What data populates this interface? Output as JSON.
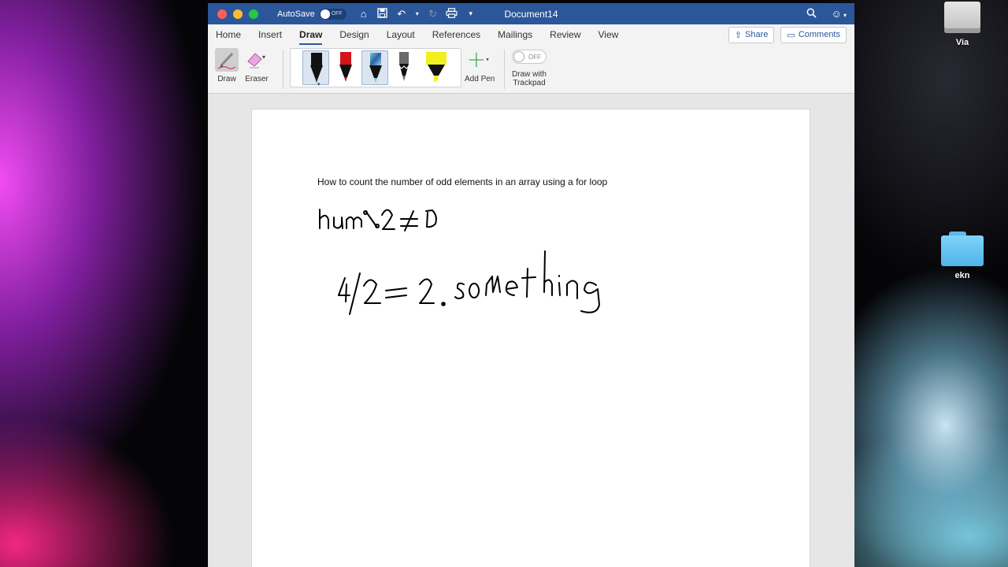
{
  "desktop": {
    "icons": [
      {
        "label": "Via",
        "type": "drive-icon"
      },
      {
        "label": "ekn",
        "type": "folder-icon"
      }
    ]
  },
  "titlebar": {
    "autosave_label": "AutoSave",
    "autosave_state": "OFF",
    "doc_title": "Document14"
  },
  "tabs": [
    "Home",
    "Insert",
    "Draw",
    "Design",
    "Layout",
    "References",
    "Mailings",
    "Review",
    "View"
  ],
  "active_tab": "Draw",
  "tab_actions": {
    "share": "Share",
    "comments": "Comments"
  },
  "ribbon": {
    "draw_label": "Draw",
    "eraser_label": "Eraser",
    "add_pen_label": "Add Pen",
    "trackpad_toggle_state": "OFF",
    "trackpad_label_line1": "Draw with",
    "trackpad_label_line2": "Trackpad",
    "pens": [
      {
        "name": "black-pen",
        "color": "#111111",
        "selected": true
      },
      {
        "name": "red-pen",
        "color": "#d2151b",
        "selected": false
      },
      {
        "name": "galaxy-pen",
        "color": "#3a8fb0",
        "selected": true
      },
      {
        "name": "gray-pencil",
        "color": "#6a6a6a",
        "selected": false
      },
      {
        "name": "yellow-highlighter",
        "color": "#f3ef1e",
        "selected": false
      }
    ]
  },
  "document": {
    "typed_text": "How to count the number of odd elements in an array using a for loop",
    "ink_line1": "hum%2≠0",
    "ink_line2": "4/2=2.something"
  },
  "colors": {
    "word_blue": "#2b579a",
    "ribbon_bg": "#f3f3f3"
  }
}
